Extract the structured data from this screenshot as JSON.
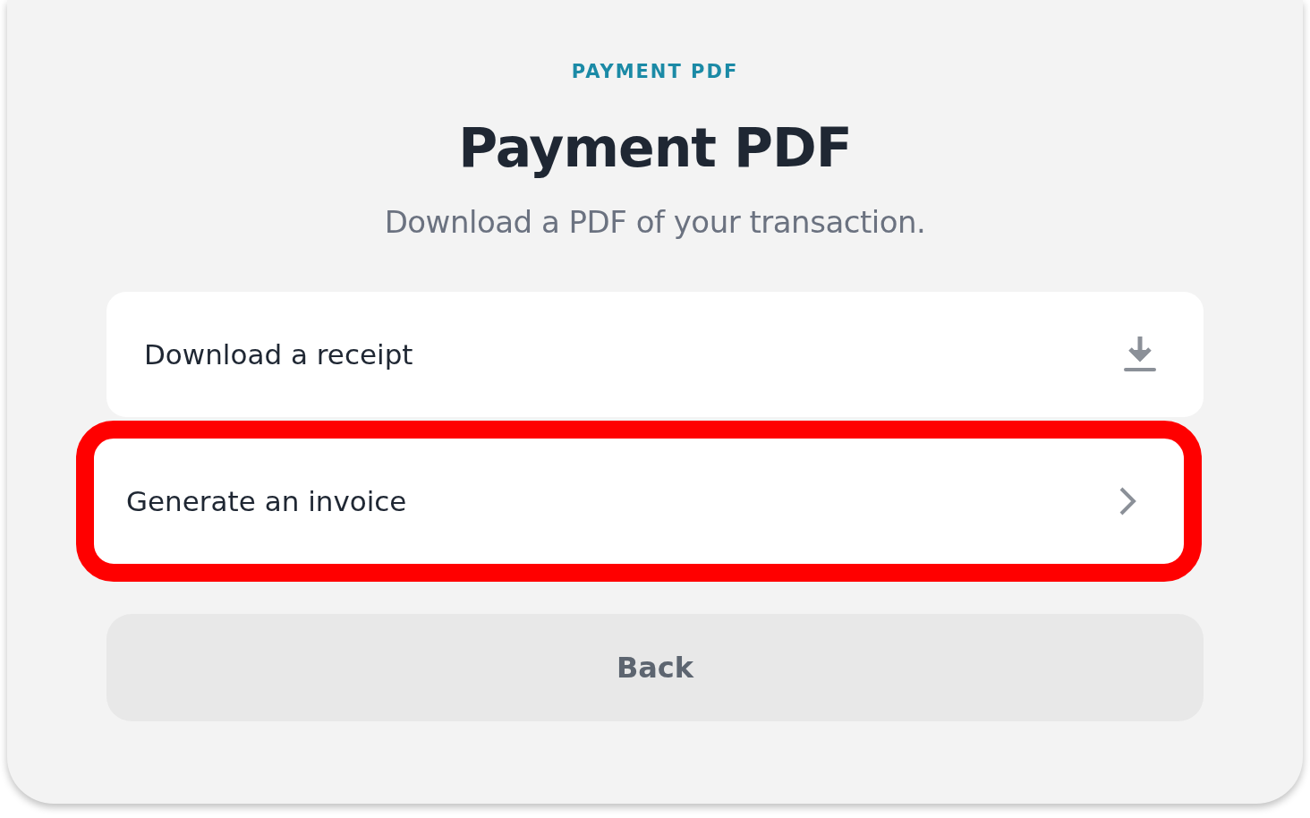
{
  "eyebrow": "PAYMENT PDF",
  "title": "Payment PDF",
  "subtitle": "Download a PDF of your transaction.",
  "options": [
    {
      "label": "Download a receipt",
      "kind": "download",
      "highlighted": false
    },
    {
      "label": "Generate an invoice",
      "kind": "navigate",
      "highlighted": true
    }
  ],
  "back_button": "Back"
}
